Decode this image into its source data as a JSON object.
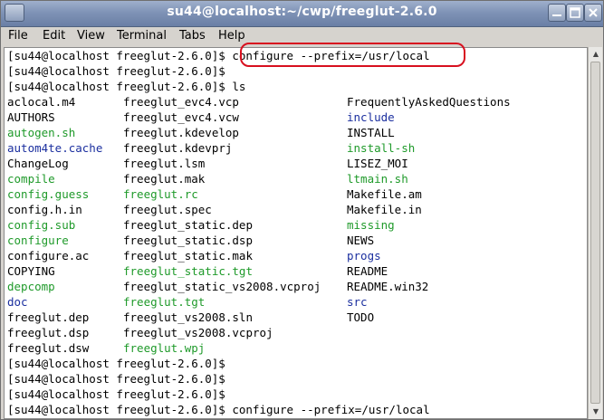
{
  "window": {
    "title": "su44@localhost:~/cwp/freeglut-2.6.0"
  },
  "menu": [
    "File",
    "Edit",
    "View",
    "Terminal",
    "Tabs",
    "Help"
  ],
  "terminal": {
    "lines": [
      [
        "[su44@localhost freeglut-2.6.0]$ configure --prefix=/usr/local"
      ],
      [
        "[su44@localhost freeglut-2.6.0]$"
      ],
      [
        "[su44@localhost freeglut-2.6.0]$ ls"
      ],
      [
        "aclocal.m4",
        "freeglut_evc4.vcp",
        "FrequentlyAskedQuestions"
      ],
      [
        "AUTHORS",
        "freeglut_evc4.vcw",
        "include"
      ],
      [
        "autogen.sh",
        "freeglut.kdevelop",
        "INSTALL"
      ],
      [
        "autom4te.cache",
        "freeglut.kdevprj",
        "install-sh"
      ],
      [
        "ChangeLog",
        "freeglut.lsm",
        "LISEZ_MOI"
      ],
      [
        "compile",
        "freeglut.mak",
        "ltmain.sh"
      ],
      [
        "config.guess",
        "freeglut.rc",
        "Makefile.am"
      ],
      [
        "config.h.in",
        "freeglut.spec",
        "Makefile.in"
      ],
      [
        "config.sub",
        "freeglut_static.dep",
        "missing"
      ],
      [
        "configure",
        "freeglut_static.dsp",
        "NEWS"
      ],
      [
        "configure.ac",
        "freeglut_static.mak",
        "progs"
      ],
      [
        "COPYING",
        "freeglut_static.tgt",
        "README"
      ],
      [
        "depcomp",
        "freeglut_static_vs2008.vcproj",
        "README.win32"
      ],
      [
        "doc",
        "freeglut.tgt",
        "src"
      ],
      [
        "freeglut.dep",
        "freeglut_vs2008.sln",
        "TODO"
      ],
      [
        "freeglut.dsp",
        "freeglut_vs2008.vcproj"
      ],
      [
        "freeglut.dsw",
        "freeglut.wpj"
      ],
      [
        "[su44@localhost freeglut-2.6.0]$"
      ],
      [
        "[su44@localhost freeglut-2.6.0]$"
      ],
      [
        "[su44@localhost freeglut-2.6.0]$"
      ],
      [
        "[su44@localhost freeglut-2.6.0]$ configure --prefix=/usr/local"
      ]
    ],
    "colors": [
      [
        "black"
      ],
      [
        "black"
      ],
      [
        "black"
      ],
      [
        "black",
        "black",
        "black"
      ],
      [
        "black",
        "black",
        "blue"
      ],
      [
        "green",
        "black",
        "black"
      ],
      [
        "blue",
        "black",
        "green"
      ],
      [
        "black",
        "black",
        "black"
      ],
      [
        "green",
        "black",
        "green"
      ],
      [
        "green",
        "green",
        "black"
      ],
      [
        "black",
        "black",
        "black"
      ],
      [
        "green",
        "black",
        "green"
      ],
      [
        "green",
        "black",
        "black"
      ],
      [
        "black",
        "black",
        "blue"
      ],
      [
        "black",
        "green",
        "black"
      ],
      [
        "green",
        "black",
        "black"
      ],
      [
        "blue",
        "green",
        "blue"
      ],
      [
        "black",
        "black",
        "black"
      ],
      [
        "black",
        "black"
      ],
      [
        "black",
        "green"
      ]
    ],
    "color_map": {
      "black": "#000000",
      "green": "#1f9a2a",
      "blue": "#1b2f9f"
    },
    "highlight_color": "#d8101f"
  }
}
